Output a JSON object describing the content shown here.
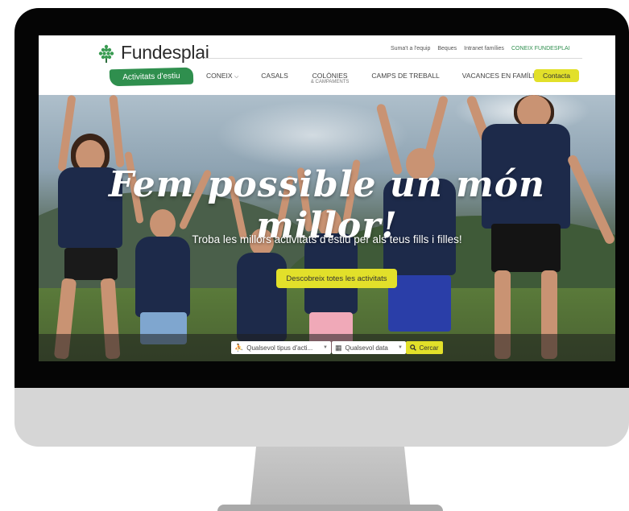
{
  "brand": {
    "name": "Fundesplai",
    "tag": "Activitats d'estiu"
  },
  "top_links": [
    "Suma't a l'equip",
    "Beques",
    "Intranet famílies",
    "CONEIX FUNDESPLAI"
  ],
  "main_nav": [
    {
      "label": "CONEIX",
      "sub": "",
      "has_dropdown": true
    },
    {
      "label": "CASALS",
      "sub": ""
    },
    {
      "label": "COLÒNIES",
      "sub": "& CAMPAMENTS"
    },
    {
      "label": "CAMPS DE TREBALL",
      "sub": ""
    },
    {
      "label": "VACANCES EN FAMÍLIA",
      "sub": ""
    }
  ],
  "contact_label": "Contacta",
  "hero": {
    "title": "Fem possible un món millor!",
    "subtitle": "Troba les millors activitats d'estiu per als teus fills i filles!",
    "cta_label": "Descobreix totes les activitats"
  },
  "search": {
    "type_value": "Qualsevol tipus d'acti...",
    "date_value": "Qualsevol data",
    "button_label": "Cercar"
  },
  "colors": {
    "accent_yellow": "#e2e02a",
    "brand_green": "#2f8f4e"
  },
  "icons": {
    "type": "people-icon",
    "date": "calendar-icon",
    "search": "search-icon"
  }
}
